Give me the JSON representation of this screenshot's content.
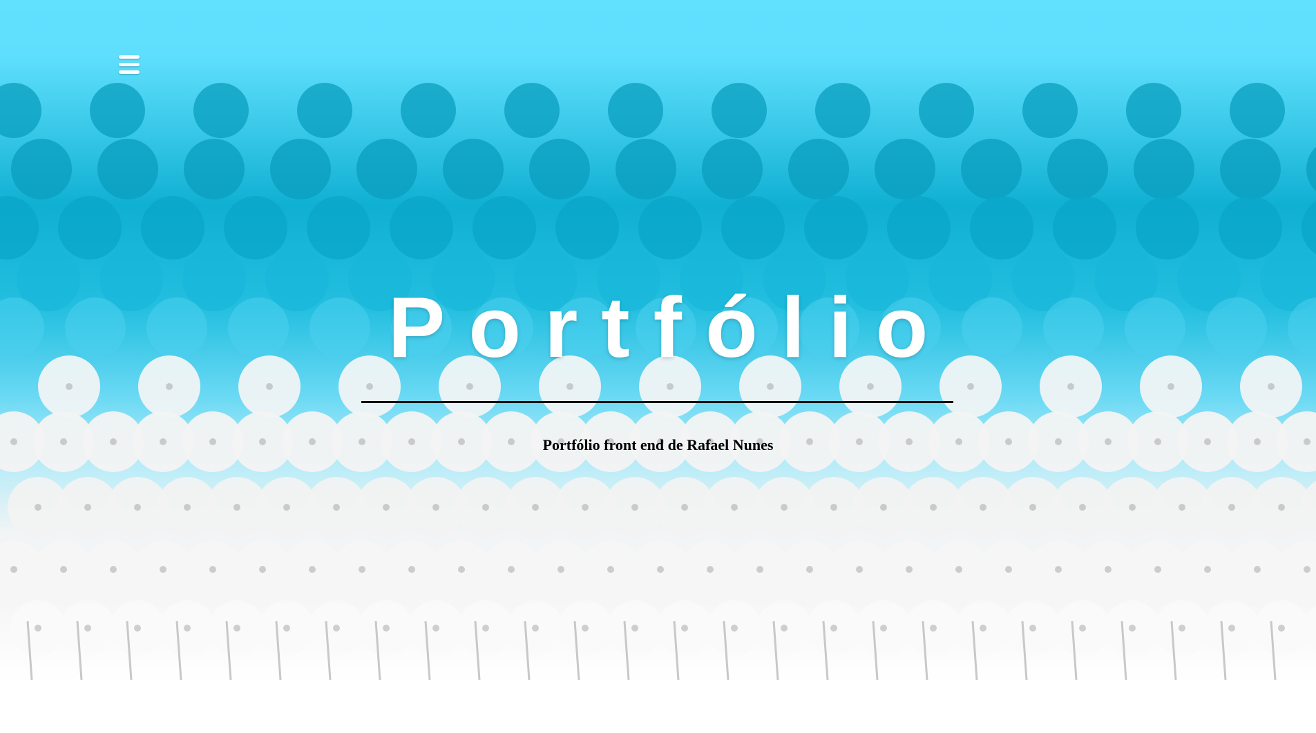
{
  "hero": {
    "title": "Portfólio",
    "subtitle": "Portfólio front end de Rafael Nunes"
  },
  "menu": {
    "icon": "hamburger-menu-icon"
  },
  "colors": {
    "sky": "#62e1fe",
    "dandelion_dark": "#0a9dbd",
    "dandelion_light": "#f4f4f4",
    "title_text": "#ffffff",
    "divider": "#111111"
  }
}
